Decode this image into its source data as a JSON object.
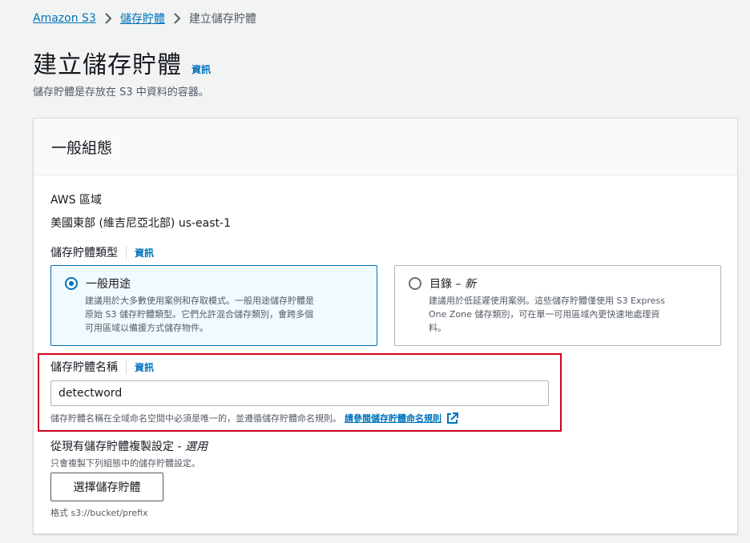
{
  "breadcrumb": {
    "items": [
      "Amazon S3",
      "儲存貯體"
    ],
    "current": "建立儲存貯體"
  },
  "page": {
    "title": "建立儲存貯體",
    "info_label": "資訊",
    "description": "儲存貯體是存放在 S3 中資料的容器。"
  },
  "panel": {
    "title": "一般組態",
    "region": {
      "label": "AWS 區域",
      "value": "美國東部 (維吉尼亞北部) us-east-1"
    },
    "bucket_type": {
      "label": "儲存貯體類型",
      "info_label": "資訊",
      "options": [
        {
          "title": "一般用途",
          "title_suffix": "",
          "description_lines": [
            "建議用於大多數使用案例和存取模式。一般用途儲存貯體是",
            "原始 S3 儲存貯體類型。它們允許混合儲存類別，會跨多個",
            "可用區域以備援方式儲存物件。"
          ],
          "selected": true
        },
        {
          "title": "目錄 – ",
          "title_suffix": "新",
          "description_lines": [
            "建議用於低延遲使用案例。這些儲存貯體僅使用 S3 Express",
            "One Zone 儲存類別，可在單一可用區域內更快速地處理資",
            "料。"
          ],
          "selected": false
        }
      ]
    },
    "bucket_name": {
      "label": "儲存貯體名稱",
      "info_label": "資訊",
      "value": "detectword",
      "constraint": "儲存貯體名稱在全域命名空間中必須是唯一的，並遵循儲存貯體命名規則。",
      "constraint_link": "請參閱儲存貯體命名規則"
    },
    "copy_settings": {
      "label": "從現有儲存貯體複製設定 - ",
      "label_optional": "選用",
      "description": "只會複製下列組態中的儲存貯體設定。",
      "button_label": "選擇儲存貯體",
      "format_hint": "格式 s3://bucket/prefix"
    }
  },
  "colors": {
    "link": "#0073bb",
    "highlight": "#d0021b",
    "selected_bg": "#f1faff"
  }
}
